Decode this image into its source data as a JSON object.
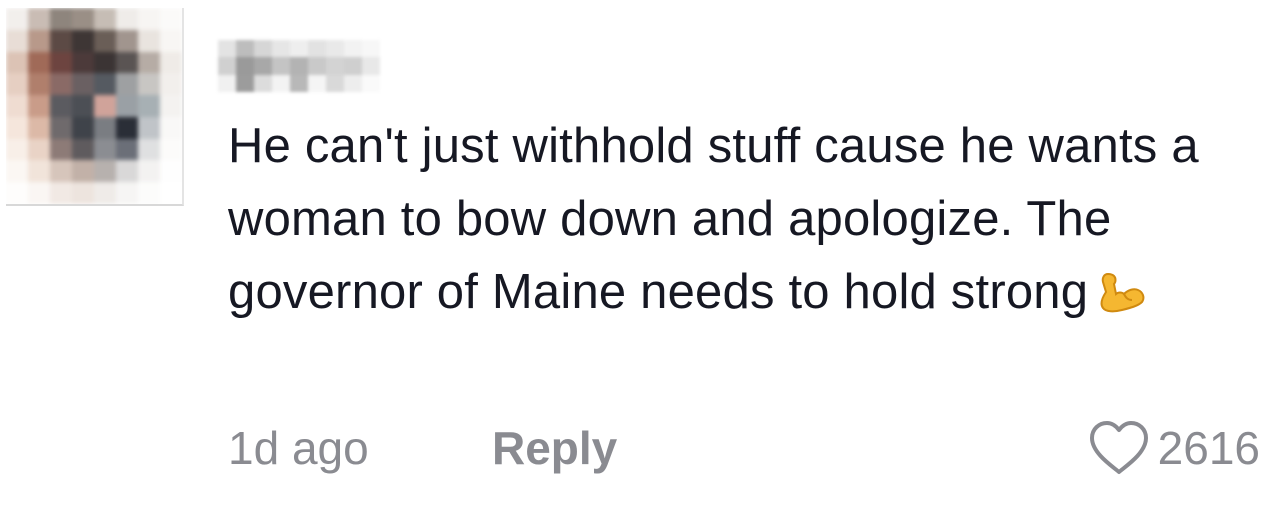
{
  "comment": {
    "text": "He can't just withhold stuff cause he wants a woman to bow down and apologize. The governor of Maine needs to hold strong",
    "emoji_icon": "flexed-biceps-icon",
    "time": "1d ago",
    "reply_label": "Reply",
    "like_icon": "heart-outline-icon",
    "like_count": "2616"
  },
  "colors": {
    "text": "#161823",
    "meta": "#8a8b91",
    "background": "#ffffff"
  }
}
